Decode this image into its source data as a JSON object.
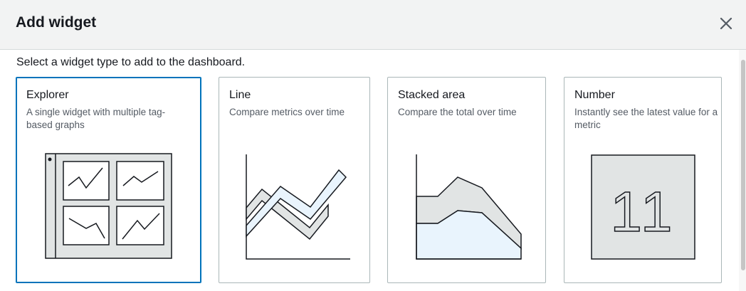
{
  "dialog": {
    "title": "Add widget",
    "close_icon": "close-icon",
    "subtitle": "Select a widget type to add to the dashboard."
  },
  "widgets": [
    {
      "title": "Explorer",
      "description": "A single widget with multiple tag-based graphs",
      "icon": "explorer-illustration-icon",
      "selected": true
    },
    {
      "title": "Line",
      "description": "Compare metrics over time",
      "icon": "line-chart-illustration-icon",
      "selected": false
    },
    {
      "title": "Stacked area",
      "description": "Compare the total over time",
      "icon": "stacked-area-illustration-icon",
      "selected": false
    },
    {
      "title": "Number",
      "description": "Instantly see the latest value for a metric",
      "icon": "number-illustration-icon",
      "selected": false,
      "number_value": "11"
    }
  ],
  "colors": {
    "selected_border": "#0073bb",
    "illustration_fill": "#e1e4e4",
    "illustration_light": "#e9f4fd",
    "stroke": "#16191f"
  }
}
